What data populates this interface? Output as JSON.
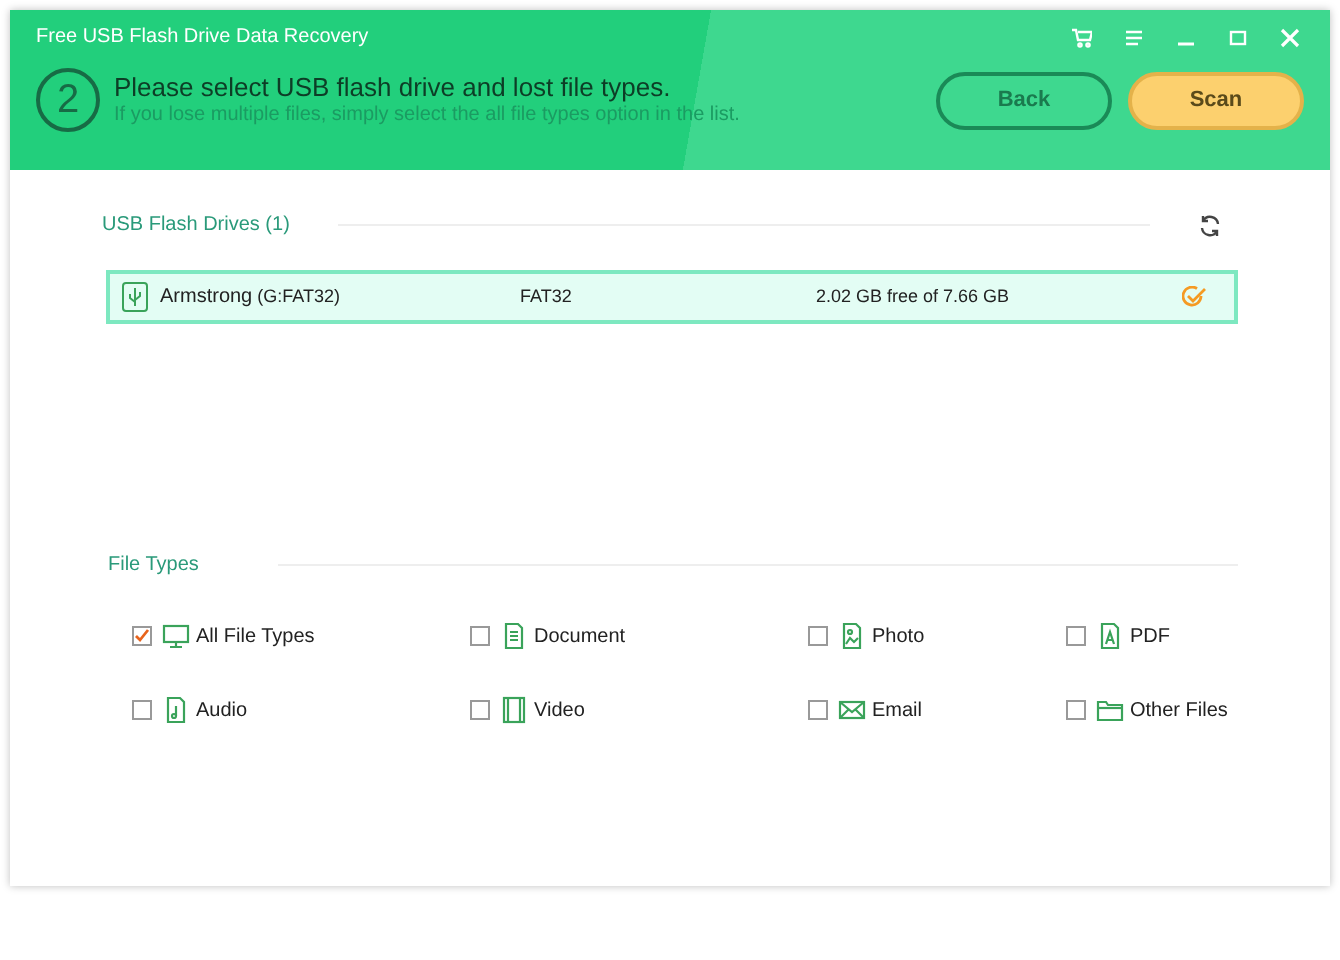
{
  "window": {
    "title": "Free USB Flash Drive Data Recovery"
  },
  "step": {
    "number": "2",
    "heading": "Please select USB flash drive and lost file types.",
    "hint": "If you lose multiple files, simply select the all file types option in the list."
  },
  "buttons": [
    {
      "label": "Back",
      "kind": "secondary"
    },
    {
      "label": "Scan",
      "kind": "primary"
    }
  ],
  "drives_section": {
    "title": "USB Flash Drives (1)"
  },
  "drives": [
    {
      "name": "Armstrong",
      "detail": "(G:FAT32)",
      "file_system": "FAT32",
      "space": "2.02 GB free of 7.66 GB",
      "selected": true
    }
  ],
  "file_types_section": {
    "title": "File Types"
  },
  "file_types": [
    {
      "label": "All File Types",
      "kind": "monitor",
      "checked": true
    },
    {
      "label": "Document",
      "kind": "document",
      "checked": false
    },
    {
      "label": "Photo",
      "kind": "photo",
      "checked": false
    },
    {
      "label": "PDF",
      "kind": "pdf",
      "checked": false
    },
    {
      "label": "Audio",
      "kind": "audio",
      "checked": false
    },
    {
      "label": "Video",
      "kind": "video",
      "checked": false
    },
    {
      "label": "Email",
      "kind": "email",
      "checked": false
    },
    {
      "label": "Other Files",
      "kind": "folder",
      "checked": false
    }
  ]
}
